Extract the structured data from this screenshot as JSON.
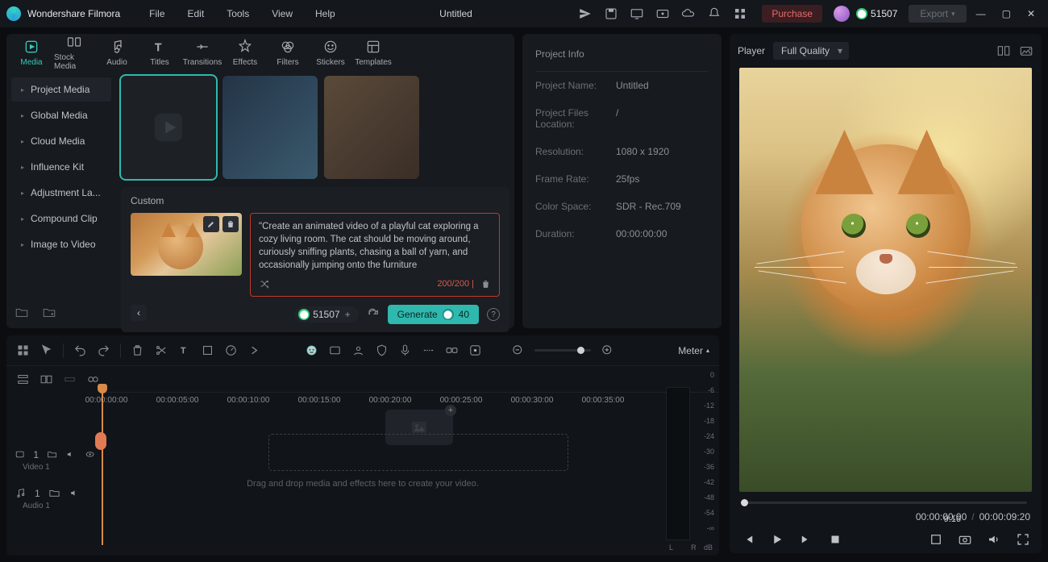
{
  "app": {
    "name": "Wondershare Filmora",
    "document": "Untitled"
  },
  "menu": {
    "file": "File",
    "edit": "Edit",
    "tools": "Tools",
    "view": "View",
    "help": "Help"
  },
  "header": {
    "purchase": "Purchase",
    "credits": "51507",
    "export": "Export"
  },
  "tabs": {
    "media": "Media",
    "stock": "Stock Media",
    "audio": "Audio",
    "titles": "Titles",
    "transitions": "Transitions",
    "effects": "Effects",
    "filters": "Filters",
    "stickers": "Stickers",
    "templates": "Templates"
  },
  "sidebar": {
    "items": [
      "Project Media",
      "Global Media",
      "Cloud Media",
      "Influence Kit",
      "Adjustment La...",
      "Compound Clip",
      "Image to Video"
    ]
  },
  "custom": {
    "title": "Custom",
    "prompt_text": "\"Create an animated video of a playful cat exploring a cozy living room. The cat should be moving around, curiously sniffing plants, chasing a ball of yarn, and occasionally jumping onto the furniture",
    "char_count": "200/200",
    "credits": "51507",
    "generate": "Generate",
    "gen_cost": "40"
  },
  "info": {
    "title": "Project Info",
    "name_label": "Project Name:",
    "name_val": "Untitled",
    "loc_label": "Project Files Location:",
    "loc_val": "/",
    "res_label": "Resolution:",
    "res_val": "1080 x 1920",
    "fps_label": "Frame Rate:",
    "fps_val": "25fps",
    "cs_label": "Color Space:",
    "cs_val": "SDR - Rec.709",
    "dur_label": "Duration:",
    "dur_val": "00:00:00:00"
  },
  "preview": {
    "player": "Player",
    "quality": "Full Quality",
    "time_current": "00:00:00:00",
    "time_total": "00:00:09:20",
    "zoom": "9:16"
  },
  "timeline": {
    "meter": "Meter",
    "ruler": [
      "00:00:00:00",
      "00:00:05:00",
      "00:00:10:00",
      "00:00:15:00",
      "00:00:20:00",
      "00:00:25:00",
      "00:00:30:00",
      "00:00:35:00"
    ],
    "video_index": "1",
    "video_label": "Video 1",
    "audio_index": "1",
    "audio_label": "Audio 1",
    "drop_hint": "Drag and drop media and effects here to create your video.",
    "db_scale": [
      "0",
      "-6",
      "-12",
      "-18",
      "-24",
      "-30",
      "-36",
      "-42",
      "-48",
      "-54",
      "-∞"
    ],
    "lr": "L   R",
    "db": "dB"
  }
}
